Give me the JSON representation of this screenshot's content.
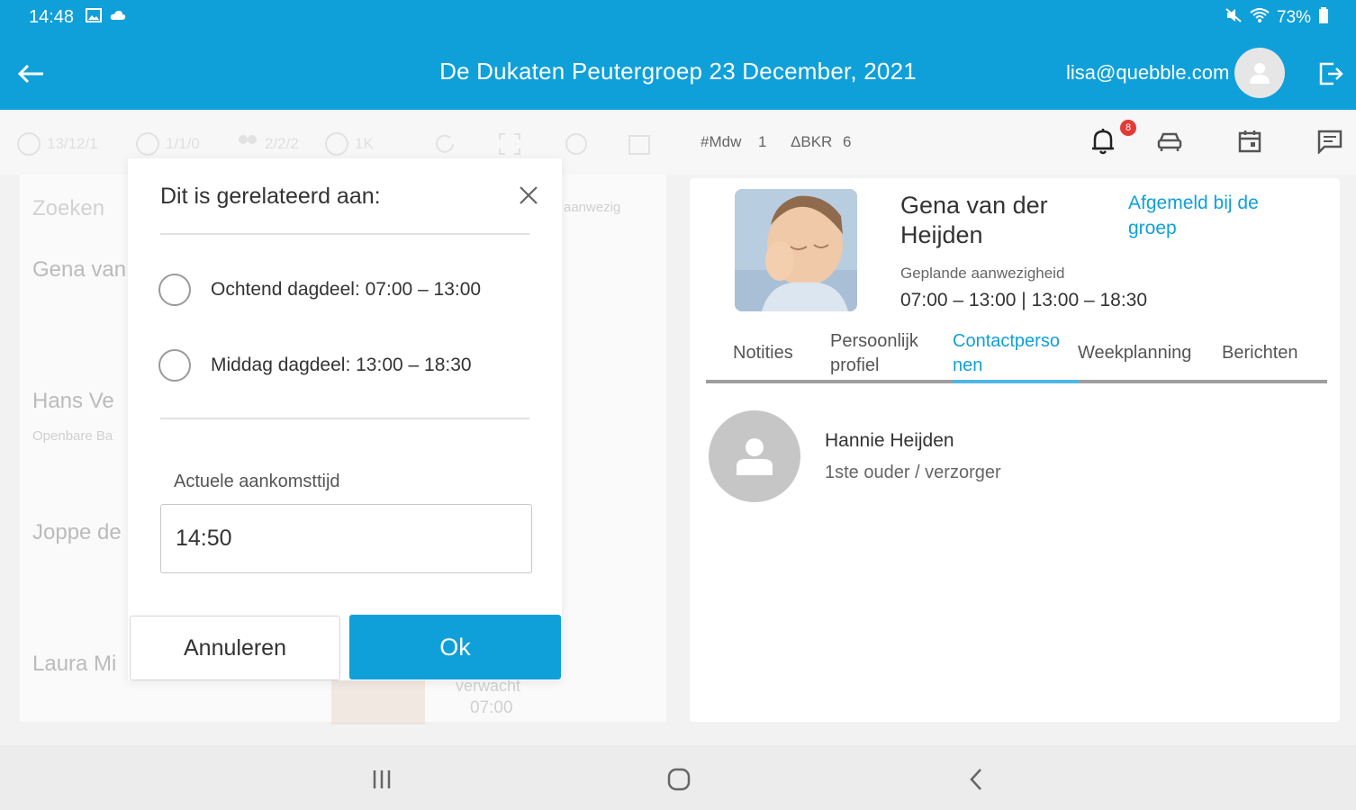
{
  "status": {
    "time": "14:48",
    "battery": "73%",
    "icons": [
      "image-icon",
      "cloud-icon",
      "mute-icon",
      "wifi-icon",
      "battery-icon"
    ]
  },
  "header": {
    "title": "De Dukaten Peutergroep 23 December, 2021",
    "user_email": "lisa@quebble.com",
    "accent_color": "#0fa0da"
  },
  "toolbar": {
    "faded_items": [
      "13/12/1",
      "1/1/0",
      "2/2/2",
      "1K"
    ],
    "counters": [
      "#Mdw",
      "1",
      "ΔBKR",
      "6"
    ],
    "notification_badge": "8",
    "icons": [
      "bell-icon",
      "car-icon",
      "calendar-icon",
      "message-icon"
    ]
  },
  "left_list": {
    "search_placeholder": "Zoeken",
    "column_hint": "aanwezig",
    "items": [
      {
        "name": "Gena van",
        "sub": ""
      },
      {
        "name": "Hans Ve",
        "sub": "Openbare Ba"
      },
      {
        "name": "Joppe de",
        "sub": ""
      },
      {
        "name": "Laura Mi",
        "sub": ""
      }
    ],
    "partial_entry": {
      "line1": "verwacht",
      "line2": "07:00"
    }
  },
  "child": {
    "name": "Gena van der Heijden",
    "status_link": "Afgemeld bij de groep",
    "planned_label": "Geplande aanwezigheid",
    "planned_times": "07:00 – 13:00 | 13:00 – 18:30"
  },
  "tabs": [
    {
      "label": "Notities"
    },
    {
      "label": "Persoonlijk profiel"
    },
    {
      "label": "Contactpersonen"
    },
    {
      "label": "Weekplanning"
    },
    {
      "label": "Berichten"
    }
  ],
  "active_tab": "Contactpersonen",
  "contact": {
    "name": "Hannie Heijden",
    "role": "1ste ouder / verzorger"
  },
  "dialog": {
    "title": "Dit is gerelateerd aan:",
    "options": [
      {
        "label": "Ochtend dagdeel: 07:00 – 13:00"
      },
      {
        "label": "Middag dagdeel: 13:00 – 18:30"
      }
    ],
    "field_label": "Actuele aankomsttijd",
    "field_value": "14:50",
    "cancel_label": "Annuleren",
    "ok_label": "Ok"
  }
}
